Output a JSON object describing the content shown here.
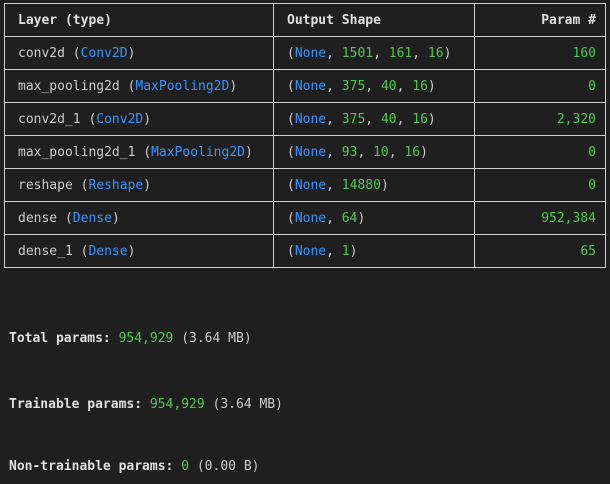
{
  "header": {
    "layer": "Layer (type)",
    "output": "Output Shape",
    "param": "Param #"
  },
  "rows": [
    {
      "name": "conv2d",
      "type": "Conv2D",
      "shape": [
        "1501",
        "161",
        "16"
      ],
      "param": "160"
    },
    {
      "name": "max_pooling2d",
      "type": "MaxPooling2D",
      "shape": [
        "375",
        "40",
        "16"
      ],
      "param": "0"
    },
    {
      "name": "conv2d_1",
      "type": "Conv2D",
      "shape": [
        "375",
        "40",
        "16"
      ],
      "param": "2,320"
    },
    {
      "name": "max_pooling2d_1",
      "type": "MaxPooling2D",
      "shape": [
        "93",
        "10",
        "16"
      ],
      "param": "0"
    },
    {
      "name": "reshape",
      "type": "Reshape",
      "shape": [
        "14880"
      ],
      "param": "0"
    },
    {
      "name": "dense",
      "type": "Dense",
      "shape": [
        "64"
      ],
      "param": "952,384"
    },
    {
      "name": "dense_1",
      "type": "Dense",
      "shape": [
        "1"
      ],
      "param": "65"
    }
  ],
  "none_label": "None",
  "totals": {
    "total": {
      "label": "Total params:",
      "value": "954,929",
      "size": "(3.64 MB)"
    },
    "trainable": {
      "label": "Trainable params:",
      "value": "954,929",
      "size": "(3.64 MB)"
    },
    "non_trainable": {
      "label": "Non-trainable params:",
      "value": "0",
      "size": "(0.00 B)"
    }
  },
  "colors": {
    "background": "#1f1f1f",
    "text": "#cccccc",
    "type_blue": "#3794ff",
    "number_green": "#4ec94e"
  }
}
